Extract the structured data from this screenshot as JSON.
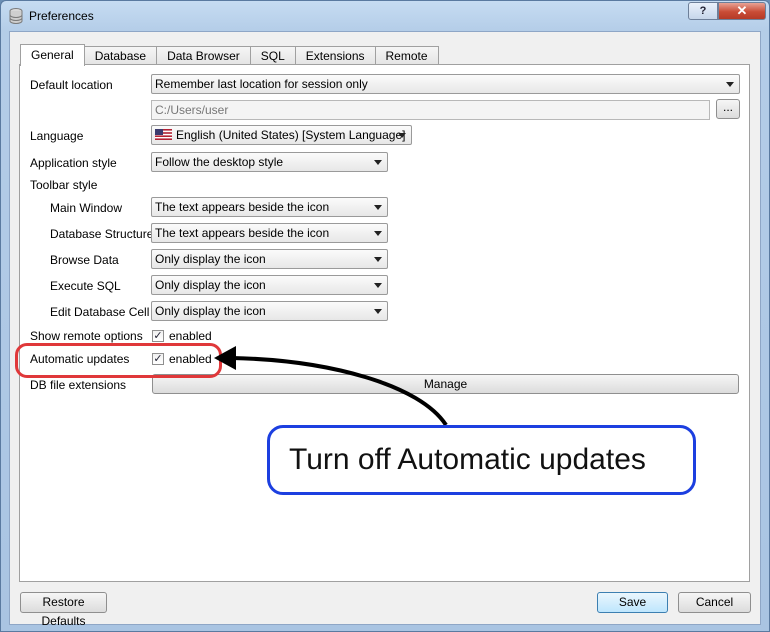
{
  "window": {
    "title": "Preferences",
    "help_label": "?",
    "close_label": "✕"
  },
  "tabs": [
    "General",
    "Database",
    "Data Browser",
    "SQL",
    "Extensions",
    "Remote"
  ],
  "general": {
    "default_location_label": "Default location",
    "default_location_value": "Remember last location for session only",
    "path_value": "C:/Users/user",
    "browse_label": "...",
    "language_label": "Language",
    "language_value": "English (United States) [System Language]",
    "app_style_label": "Application style",
    "app_style_value": "Follow the desktop style",
    "toolbar_style_label": "Toolbar style",
    "main_window_label": "Main Window",
    "main_window_value": "The text appears beside the icon",
    "db_structure_label": "Database Structure",
    "db_structure_value": "The text appears beside the icon",
    "browse_data_label": "Browse Data",
    "browse_data_value": "Only display the icon",
    "execute_sql_label": "Execute SQL",
    "execute_sql_value": "Only display the icon",
    "edit_cell_label": "Edit Database Cell",
    "edit_cell_value": "Only display the icon",
    "remote_options_label": "Show remote options",
    "remote_options_check": "enabled",
    "auto_updates_label": "Automatic updates",
    "auto_updates_check": "enabled",
    "db_ext_label": "DB file extensions",
    "manage_label": "Manage"
  },
  "footer": {
    "restore_label": "Restore Defaults",
    "save_label": "Save",
    "cancel_label": "Cancel"
  },
  "annotation": {
    "callout_text": "Turn off Automatic updates",
    "highlight_color": "#e0383a",
    "callout_color": "#1c3fe0"
  },
  "icons": {
    "app": "database-icon",
    "language": "us-flag-icon",
    "check": "checkmark-icon"
  }
}
